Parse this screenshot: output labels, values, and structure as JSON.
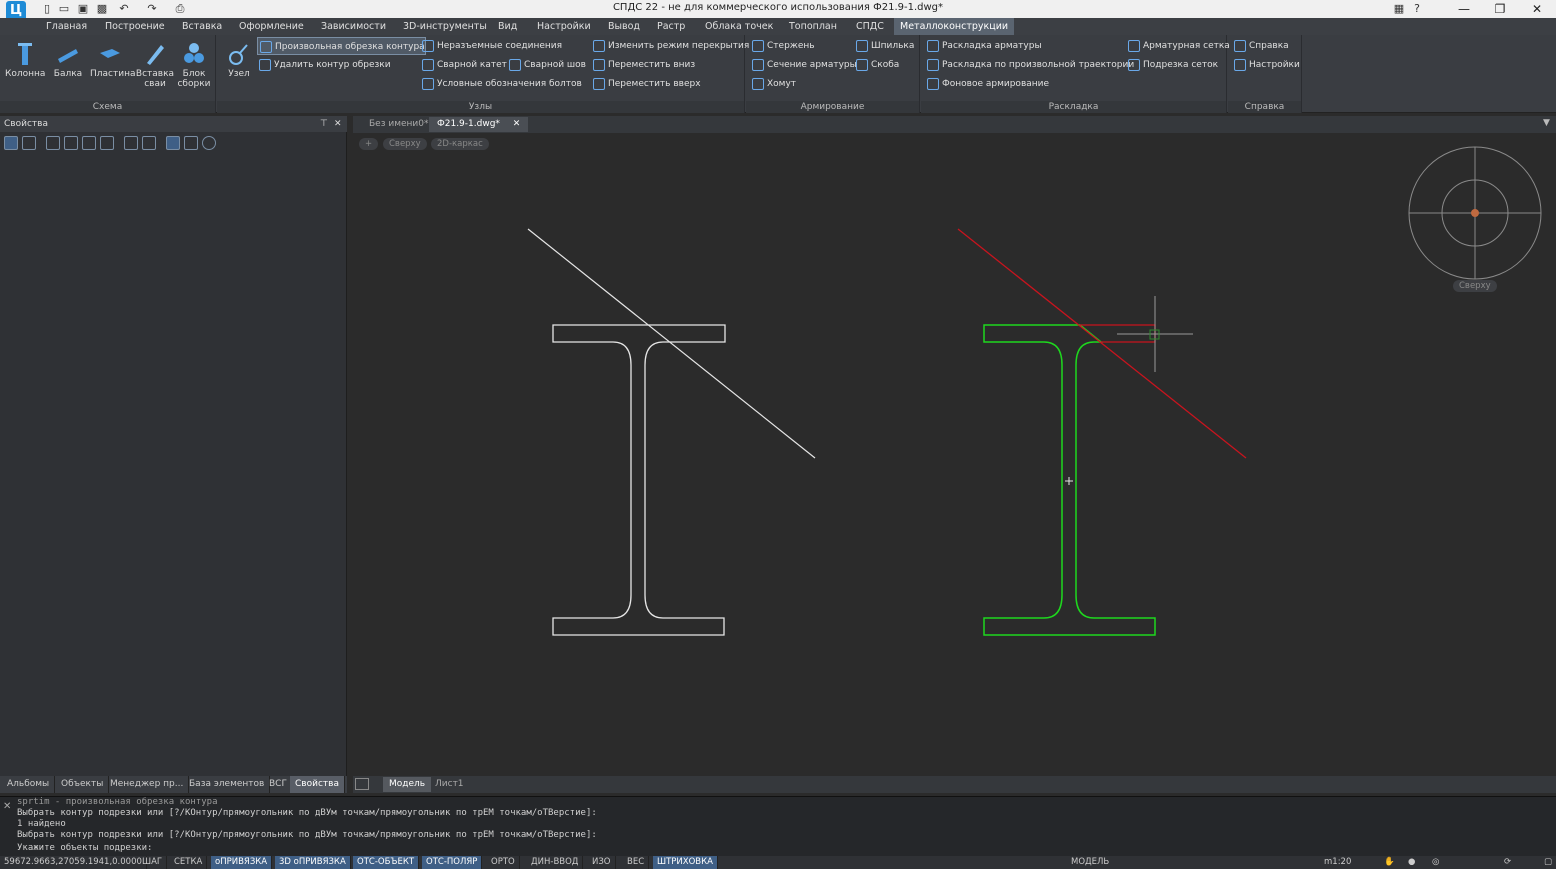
{
  "title_bar": {
    "title": "СПДС 22 - не для коммерческого использования Ф21.9-1.dwg*",
    "app_logo": "Ц",
    "minimize": "—",
    "restore": "❐",
    "close": "✕",
    "help": "?"
  },
  "menu_tabs": [
    "Главная",
    "Построение",
    "Вставка",
    "Оформление",
    "Зависимости",
    "3D-инструменты",
    "Вид",
    "Настройки",
    "Вывод",
    "Растр",
    "Облака точек",
    "Топоплан",
    "СПДС",
    "Металлоконструкции"
  ],
  "ribbon": {
    "schema": {
      "title": "Схема",
      "buttons": [
        "Колонна",
        "Балка",
        "Пластина",
        "Вставка сваи",
        "Блок сборки"
      ]
    },
    "nodes": {
      "title": "Узлы",
      "big_button": "Узел",
      "col1": [
        "Произвольная обрезка контура",
        "Удалить контур обрезки"
      ],
      "col2": [
        "Неразъемные соединения",
        "Сварной катет",
        "Условные обозначения болтов"
      ],
      "col2b": [
        "Сварной шов"
      ],
      "col3": [
        "Изменить режим перекрытия",
        "Переместить вниз",
        "Переместить вверх"
      ]
    },
    "reinforcement": {
      "title": "Армирование",
      "col1": [
        "Стержень",
        "Сечение арматуры",
        "Хомут"
      ],
      "col2": [
        "Шпилька",
        "Скоба"
      ]
    },
    "layout": {
      "title": "Раскладка",
      "col1": [
        "Раскладка арматуры",
        "Раскладка по произвольной траектории",
        "Фоновое армирование"
      ],
      "col2": [
        "Арматурная сетка",
        "Подрезка сеток"
      ]
    },
    "help": {
      "title": "Справка",
      "items": [
        "Справка",
        "Настройки"
      ]
    }
  },
  "left_panel": {
    "title": "Свойства",
    "tabs": [
      "Альбомы",
      "Объекты",
      "Менеджер пр...",
      "База элементов",
      "ВСГ",
      "Свойства"
    ]
  },
  "doc_tabs": [
    "Без имени0*",
    "Ф21.9-1.dwg*"
  ],
  "viewport": {
    "btn_plus": "+",
    "view": "Сверху",
    "style": "2D-каркас",
    "viewcube_label": "Сверху"
  },
  "layout_tabs": [
    "Модель",
    "Лист1"
  ],
  "command_lines": [
    "sprtim - произвольная обрезка контура",
    "Выбрать контур подрезки или [?/КОнтур/прямоугольник по дВУм точкам/прямоугольник по трЕМ точкам/оТВерстие]:",
    "1 найдено",
    "Выбрать контур подрезки или [?/КОнтур/прямоугольник по дВУм точкам/прямоугольник по трЕМ точкам/оТВерстие]:",
    "Укажите объекты подрезки:"
  ],
  "status_bar": {
    "coords": "59672.9663,27059.1941,0.0000",
    "toggles": [
      {
        "label": "ШАГ",
        "on": false
      },
      {
        "label": "СЕТКА",
        "on": false
      },
      {
        "label": "оПРИВЯЗКА",
        "on": true
      },
      {
        "label": "3D оПРИВЯЗКА",
        "on": true
      },
      {
        "label": "ОТС-ОБЪЕКТ",
        "on": true
      },
      {
        "label": "ОТС-ПОЛЯР",
        "on": true
      },
      {
        "label": "ОРТО",
        "on": false
      },
      {
        "label": "ДИН-ВВОД",
        "on": false
      },
      {
        "label": "ИЗО",
        "on": false
      },
      {
        "label": "ВЕС",
        "on": false
      },
      {
        "label": "ШТРИХОВКА",
        "on": true
      }
    ],
    "model": "МОДЕЛЬ",
    "scale": "m1:20"
  },
  "colors": {
    "selected_profile": "#1ed81e",
    "trim_line": "#c8141e",
    "unselected_profile": "#e6e6e6",
    "accent": "#3f5f86"
  }
}
